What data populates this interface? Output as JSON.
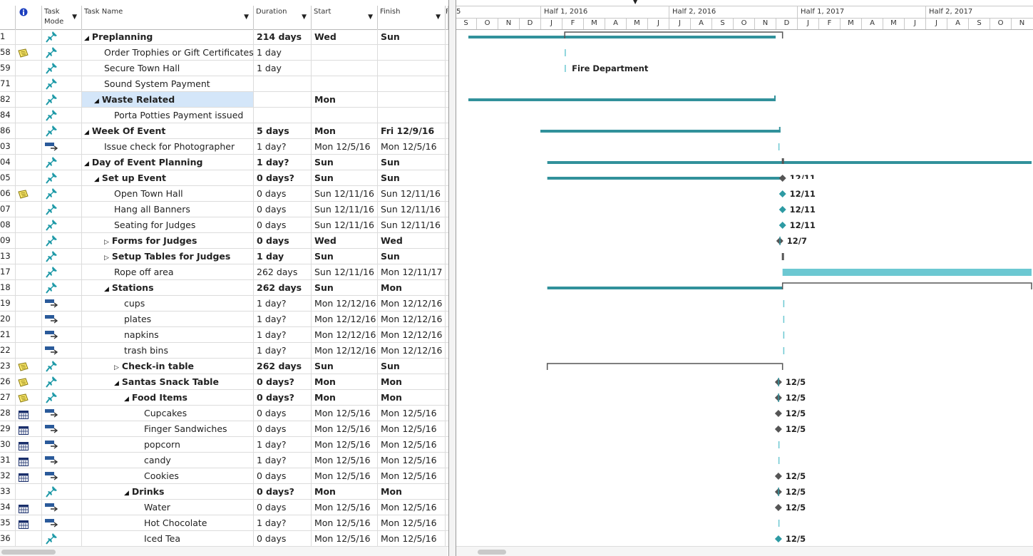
{
  "columns": {
    "mode": "Task Mode",
    "name": "Task Name",
    "duration": "Duration",
    "start": "Start",
    "finish": "Finish",
    "extra": "F"
  },
  "timescale": {
    "halves": [
      "Half 1, 2016",
      "Half 2, 2016",
      "Half 1, 2017",
      "Half 2, 2017"
    ],
    "months": [
      "S",
      "O",
      "N",
      "D",
      "J",
      "F",
      "M",
      "A",
      "M",
      "J",
      "J",
      "A",
      "S",
      "O",
      "N",
      "D",
      "J",
      "F",
      "M",
      "A",
      "M",
      "J",
      "J",
      "A",
      "S",
      "O",
      "N"
    ],
    "partial_left": "5"
  },
  "colors": {
    "bar": "#31919b",
    "bar_light": "#6cc8d2",
    "summary": "#555555",
    "milestone_auto": "#2d9aa3",
    "milestone_manual": "#555555",
    "selection": "#d4e6f9"
  },
  "rows": [
    {
      "id": "1",
      "note": false,
      "mode": "manual",
      "level": 0,
      "tri": "down",
      "name": "Preplanning",
      "bold": true,
      "duration": "214 days",
      "start": "Wed",
      "finish": "Sun",
      "selected": false
    },
    {
      "id": "58",
      "note": true,
      "mode": "manual",
      "level": 1,
      "tri": "",
      "name": "Order Trophies or Gift Certificates",
      "bold": false,
      "duration": "1 day",
      "start": "",
      "finish": "",
      "selected": false
    },
    {
      "id": "59",
      "note": false,
      "mode": "manual",
      "level": 1,
      "tri": "",
      "name": "Secure Town Hall",
      "bold": false,
      "duration": "1 day",
      "start": "",
      "finish": "",
      "selected": false
    },
    {
      "id": "71",
      "note": false,
      "mode": "manual",
      "level": 1,
      "tri": "",
      "name": "Sound System Payment",
      "bold": false,
      "duration": "",
      "start": "",
      "finish": "",
      "selected": false
    },
    {
      "id": "82",
      "note": false,
      "mode": "manual",
      "level": 1,
      "tri": "down",
      "name": "Waste Related",
      "bold": true,
      "duration": "",
      "start": "Mon",
      "finish": "",
      "selected": true
    },
    {
      "id": "84",
      "note": false,
      "mode": "manual",
      "level": 2,
      "tri": "",
      "name": "Porta Potties Payment issued",
      "bold": false,
      "duration": "",
      "start": "",
      "finish": "",
      "selected": false
    },
    {
      "id": "86",
      "note": false,
      "mode": "manual",
      "level": 0,
      "tri": "down",
      "name": "Week Of Event",
      "bold": true,
      "duration": "5 days",
      "start": "Mon",
      "finish": "Fri 12/9/16",
      "selected": false
    },
    {
      "id": "03",
      "note": false,
      "mode": "auto",
      "level": 1,
      "tri": "",
      "name": "Issue check for Photographer",
      "bold": false,
      "duration": "1 day?",
      "start": "Mon 12/5/16",
      "finish": "Mon 12/5/16",
      "selected": false
    },
    {
      "id": "04",
      "note": false,
      "mode": "manual",
      "level": 0,
      "tri": "down",
      "name": "Day of Event Planning",
      "bold": true,
      "duration": "1 day?",
      "start": "Sun",
      "finish": "Sun",
      "selected": false
    },
    {
      "id": "05",
      "note": false,
      "mode": "manual",
      "level": 1,
      "tri": "down",
      "name": "Set up Event",
      "bold": true,
      "duration": "0 days?",
      "start": "Sun",
      "finish": "Sun",
      "selected": false
    },
    {
      "id": "06",
      "note": true,
      "mode": "manual",
      "level": 2,
      "tri": "",
      "name": "Open Town Hall",
      "bold": false,
      "duration": "0 days",
      "start": "Sun 12/11/16",
      "finish": "Sun 12/11/16",
      "selected": false
    },
    {
      "id": "07",
      "note": false,
      "mode": "manual",
      "level": 2,
      "tri": "",
      "name": "Hang all Banners",
      "bold": false,
      "duration": "0 days",
      "start": "Sun 12/11/16",
      "finish": "Sun 12/11/16",
      "selected": false
    },
    {
      "id": "08",
      "note": false,
      "mode": "manual",
      "level": 2,
      "tri": "",
      "name": "Seating for Judges",
      "bold": false,
      "duration": "0 days",
      "start": "Sun 12/11/16",
      "finish": "Sun 12/11/16",
      "selected": false
    },
    {
      "id": "09",
      "note": false,
      "mode": "manual",
      "level": 2,
      "tri": "right",
      "name": "Forms for Judges",
      "bold": true,
      "duration": "0 days",
      "start": "Wed",
      "finish": "Wed",
      "selected": false
    },
    {
      "id": "13",
      "note": false,
      "mode": "manual",
      "level": 2,
      "tri": "right",
      "name": "Setup Tables for Judges",
      "bold": true,
      "duration": "1 day",
      "start": "Sun",
      "finish": "Sun",
      "selected": false
    },
    {
      "id": "17",
      "note": false,
      "mode": "manual",
      "level": 2,
      "tri": "",
      "name": "Rope off area",
      "bold": false,
      "duration": "262 days",
      "start": "Sun 12/11/16",
      "finish": "Mon 12/11/17",
      "selected": false
    },
    {
      "id": "18",
      "note": false,
      "mode": "manual",
      "level": 2,
      "tri": "down",
      "name": "Stations",
      "bold": true,
      "duration": "262 days",
      "start": "Sun",
      "finish": "Mon",
      "selected": false
    },
    {
      "id": "19",
      "note": false,
      "mode": "auto",
      "level": 3,
      "tri": "",
      "name": "cups",
      "bold": false,
      "duration": "1 day?",
      "start": "Mon 12/12/16",
      "finish": "Mon 12/12/16",
      "selected": false
    },
    {
      "id": "20",
      "note": false,
      "mode": "auto",
      "level": 3,
      "tri": "",
      "name": "plates",
      "bold": false,
      "duration": "1 day?",
      "start": "Mon 12/12/16",
      "finish": "Mon 12/12/16",
      "selected": false
    },
    {
      "id": "21",
      "note": false,
      "mode": "auto",
      "level": 3,
      "tri": "",
      "name": "napkins",
      "bold": false,
      "duration": "1 day?",
      "start": "Mon 12/12/16",
      "finish": "Mon 12/12/16",
      "selected": false
    },
    {
      "id": "22",
      "note": false,
      "mode": "auto",
      "level": 3,
      "tri": "",
      "name": "trash bins",
      "bold": false,
      "duration": "1 day?",
      "start": "Mon 12/12/16",
      "finish": "Mon 12/12/16",
      "selected": false
    },
    {
      "id": "23",
      "note": true,
      "mode": "manual",
      "level": 3,
      "tri": "right",
      "name": "Check-in table",
      "bold": true,
      "duration": "262 days",
      "start": "Sun",
      "finish": "Sun",
      "selected": false
    },
    {
      "id": "26",
      "note": true,
      "mode": "manual",
      "level": 3,
      "tri": "down",
      "name": "Santas Snack Table",
      "bold": true,
      "duration": "0 days?",
      "start": "Mon",
      "finish": "Mon",
      "selected": false
    },
    {
      "id": "27",
      "note": true,
      "mode": "manual",
      "level": 4,
      "tri": "down",
      "name": "Food Items",
      "bold": true,
      "duration": "0 days?",
      "start": "Mon",
      "finish": "Mon",
      "selected": false
    },
    {
      "id": "28",
      "note": "cal",
      "mode": "auto",
      "level": 5,
      "tri": "",
      "name": "Cupcakes",
      "bold": false,
      "duration": "0 days",
      "start": "Mon 12/5/16",
      "finish": "Mon 12/5/16",
      "selected": false
    },
    {
      "id": "29",
      "note": "cal",
      "mode": "auto",
      "level": 5,
      "tri": "",
      "name": "Finger Sandwiches",
      "bold": false,
      "duration": "0 days",
      "start": "Mon 12/5/16",
      "finish": "Mon 12/5/16",
      "selected": false
    },
    {
      "id": "30",
      "note": "cal",
      "mode": "auto",
      "level": 5,
      "tri": "",
      "name": "popcorn",
      "bold": false,
      "duration": "1 day?",
      "start": "Mon 12/5/16",
      "finish": "Mon 12/5/16",
      "selected": false
    },
    {
      "id": "31",
      "note": "cal",
      "mode": "auto",
      "level": 5,
      "tri": "",
      "name": "candy",
      "bold": false,
      "duration": "1 day?",
      "start": "Mon 12/5/16",
      "finish": "Mon 12/5/16",
      "selected": false
    },
    {
      "id": "32",
      "note": "cal",
      "mode": "auto",
      "level": 5,
      "tri": "",
      "name": "Cookies",
      "bold": false,
      "duration": "0 days",
      "start": "Mon 12/5/16",
      "finish": "Mon 12/5/16",
      "selected": false
    },
    {
      "id": "33",
      "note": false,
      "mode": "manual",
      "level": 4,
      "tri": "down",
      "name": "Drinks",
      "bold": true,
      "duration": "0 days?",
      "start": "Mon",
      "finish": "Mon",
      "selected": false
    },
    {
      "id": "34",
      "note": "cal",
      "mode": "auto",
      "level": 5,
      "tri": "",
      "name": "Water",
      "bold": false,
      "duration": "0 days",
      "start": "Mon 12/5/16",
      "finish": "Mon 12/5/16",
      "selected": false
    },
    {
      "id": "35",
      "note": "cal",
      "mode": "auto",
      "level": 5,
      "tri": "",
      "name": "Hot Chocolate",
      "bold": false,
      "duration": "1 day?",
      "start": "Mon 12/5/16",
      "finish": "Mon 12/5/16",
      "selected": false
    },
    {
      "id": "36",
      "note": false,
      "mode": "manual",
      "level": 5,
      "tri": "",
      "name": "Iced Tea",
      "bold": false,
      "duration": "0 days",
      "start": "Mon 12/5/16",
      "finish": "Mon 12/5/16",
      "selected": false
    }
  ],
  "gantt": {
    "timeline": {
      "start": "2015-09-01",
      "end": "2017-11-30"
    },
    "items": [
      {
        "row": 0,
        "kind": "bar",
        "from": "2015-09-20",
        "to": "2016-12-01",
        "style": "dark",
        "bracket_from": "2016-02-05",
        "bracket_to": "2016-12-11"
      },
      {
        "row": 1,
        "kind": "dash",
        "date": "2016-02-05"
      },
      {
        "row": 2,
        "kind": "dash",
        "date": "2016-02-05",
        "label": "Fire Department"
      },
      {
        "row": 4,
        "kind": "bar",
        "from": "2015-09-20",
        "to": "2016-12-01",
        "style": "dark",
        "capright": true
      },
      {
        "row": 6,
        "kind": "bar",
        "from": "2016-01-01",
        "to": "2016-12-08",
        "style": "dark",
        "capright": true
      },
      {
        "row": 7,
        "kind": "dash",
        "date": "2016-12-05"
      },
      {
        "row": 8,
        "kind": "bar",
        "from": "2016-01-11",
        "to": "2017-11-30",
        "style": "dark",
        "capleft": "2016-12-11"
      },
      {
        "row": 9,
        "kind": "bar",
        "from": "2016-01-11",
        "to": "2016-12-11",
        "style": "dark",
        "milestone": "2016-12-11",
        "mkind": "manual",
        "label": "12/11",
        "cut": true
      },
      {
        "row": 10,
        "kind": "milestone",
        "date": "2016-12-11",
        "mkind": "auto",
        "label": "12/11"
      },
      {
        "row": 11,
        "kind": "milestone",
        "date": "2016-12-11",
        "mkind": "auto",
        "label": "12/11"
      },
      {
        "row": 12,
        "kind": "milestone",
        "date": "2016-12-11",
        "mkind": "auto",
        "label": "12/11"
      },
      {
        "row": 13,
        "kind": "milestone",
        "date": "2016-12-07",
        "mkind": "manual",
        "label": "12/7"
      },
      {
        "row": 14,
        "kind": "tick",
        "date": "2016-12-11"
      },
      {
        "row": 15,
        "kind": "bar",
        "from": "2016-12-11",
        "to": "2017-11-30",
        "style": "light"
      },
      {
        "row": 16,
        "kind": "bar",
        "from": "2016-01-11",
        "to": "2016-12-11",
        "style": "dark",
        "bracket_from": "2016-12-11",
        "bracket_to": "2017-11-30"
      },
      {
        "row": 17,
        "kind": "dash",
        "date": "2016-12-12"
      },
      {
        "row": 18,
        "kind": "dash",
        "date": "2016-12-12"
      },
      {
        "row": 19,
        "kind": "dash",
        "date": "2016-12-12"
      },
      {
        "row": 20,
        "kind": "dash",
        "date": "2016-12-12"
      },
      {
        "row": 21,
        "kind": "bracket",
        "from": "2016-01-11",
        "to": "2016-12-11"
      },
      {
        "row": 22,
        "kind": "milestone",
        "date": "2016-12-05",
        "mkind": "manual",
        "label": "12/5"
      },
      {
        "row": 23,
        "kind": "milestone",
        "date": "2016-12-05",
        "mkind": "manual",
        "label": "12/5"
      },
      {
        "row": 24,
        "kind": "milestone",
        "date": "2016-12-05",
        "mkind": "grey",
        "label": "12/5"
      },
      {
        "row": 25,
        "kind": "milestone",
        "date": "2016-12-05",
        "mkind": "grey",
        "label": "12/5"
      },
      {
        "row": 26,
        "kind": "dash",
        "date": "2016-12-05"
      },
      {
        "row": 27,
        "kind": "dash",
        "date": "2016-12-05"
      },
      {
        "row": 28,
        "kind": "milestone",
        "date": "2016-12-05",
        "mkind": "grey",
        "label": "12/5"
      },
      {
        "row": 29,
        "kind": "milestone",
        "date": "2016-12-05",
        "mkind": "manual",
        "label": "12/5"
      },
      {
        "row": 30,
        "kind": "milestone",
        "date": "2016-12-05",
        "mkind": "grey",
        "label": "12/5"
      },
      {
        "row": 31,
        "kind": "dash",
        "date": "2016-12-05"
      },
      {
        "row": 32,
        "kind": "milestone",
        "date": "2016-12-05",
        "mkind": "auto",
        "label": "12/5"
      }
    ]
  }
}
